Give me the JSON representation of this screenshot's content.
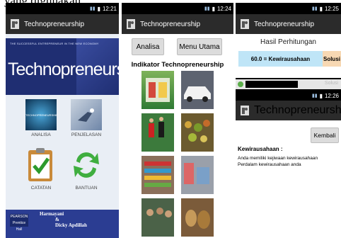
{
  "caption": "yang digunakan",
  "status": {
    "p1_time": "12:21",
    "p2_time": "12:24",
    "p3_time": "12:25",
    "p3b_time": "12:26"
  },
  "app": {
    "title": "Technopreneurship"
  },
  "screen1": {
    "banner_tagline": "THE SUCCESSFUL ENTREPRENEUR IN THE NEW ECONOMY",
    "banner_title": "Technopreneurship",
    "tiles": [
      {
        "label": "ANALISA",
        "art_text": "TECHNOPRENEURSHIP"
      },
      {
        "label": "PENJELASAN"
      },
      {
        "label": "CATATAN"
      },
      {
        "label": "BANTUAN"
      }
    ],
    "publisher": "PEARSON",
    "publisher_sub": "Prentice Hall",
    "authors": [
      "Harmayani",
      "&",
      "Dicky Apdillah"
    ]
  },
  "screen2": {
    "btn_analisa": "Analisa",
    "btn_menu": "Menu Utama",
    "heading": "Indikator Technopreneurship"
  },
  "screen3": {
    "hasil_title": "Hasil Perhitungan",
    "result_text": "60.0 = Kewirausahaan",
    "solusi_label": "Solusi",
    "notif_ghost": "Solusi",
    "kembali_label": "Kembali",
    "kw_title": "Kewirausahaan :",
    "kw_lines": [
      "Anda memiliki kejiwaan kewirausahaan",
      "Perdalam kewirausahaan anda"
    ]
  },
  "colors": {
    "banner": "#1f2e72",
    "result_bg": "#bfe5f7",
    "solusi_bg": "#f7d8b3",
    "actionbar": "#2b2b2b"
  },
  "icons": [
    "app-icon",
    "signal-icon",
    "battery-icon",
    "checklist-icon",
    "refresh-icon"
  ]
}
